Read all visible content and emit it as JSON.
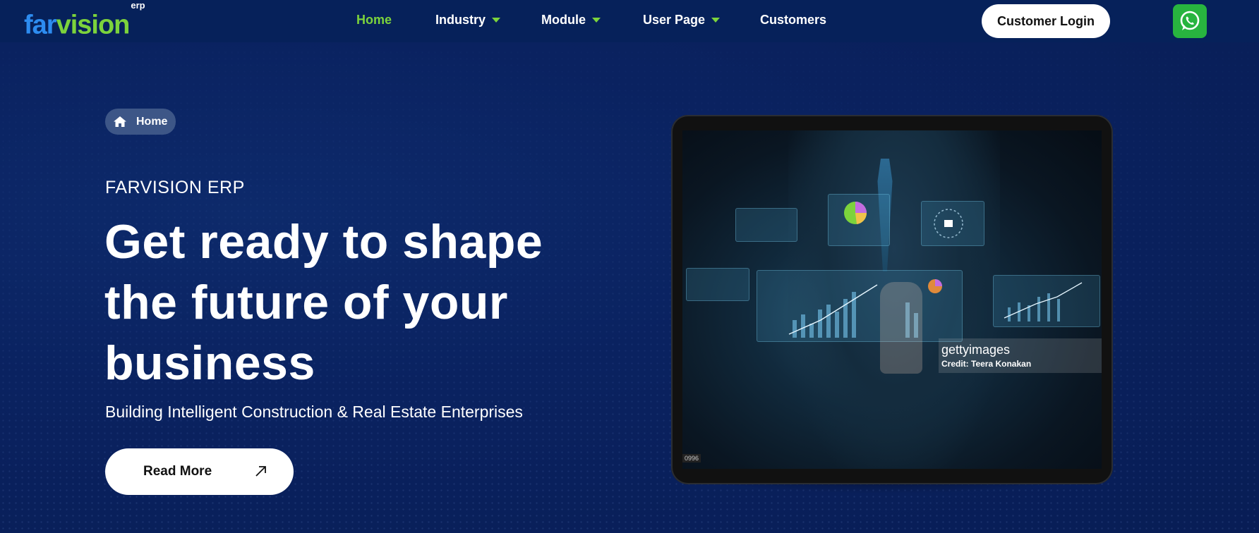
{
  "brand": {
    "logo_part1": "far",
    "logo_part2": "vision",
    "logo_sup": "erp"
  },
  "nav": {
    "items": [
      {
        "label": "Home",
        "active": true,
        "dropdown": false
      },
      {
        "label": "Industry",
        "active": false,
        "dropdown": true
      },
      {
        "label": "Module",
        "active": false,
        "dropdown": true
      },
      {
        "label": "User Page",
        "active": false,
        "dropdown": true
      },
      {
        "label": "Customers",
        "active": false,
        "dropdown": false
      }
    ],
    "login_label": "Customer Login",
    "whatsapp_icon": "whatsapp-icon"
  },
  "hero": {
    "breadcrumb": "Home",
    "eyebrow": "FARVISION ERP",
    "headline": "Get ready to shape the future of your business",
    "subtitle": "Building Intelligent Construction & Real Estate Enterprises",
    "cta_label": "Read More"
  },
  "image": {
    "watermark_brand": "gettyimages",
    "watermark_credit": "Credit: Teera Konakan",
    "tag": "0996"
  },
  "colors": {
    "background": "#0a2260",
    "accent_green": "#7cd33c",
    "logo_blue": "#2d8cf0",
    "whatsapp_green": "#28b43f"
  }
}
